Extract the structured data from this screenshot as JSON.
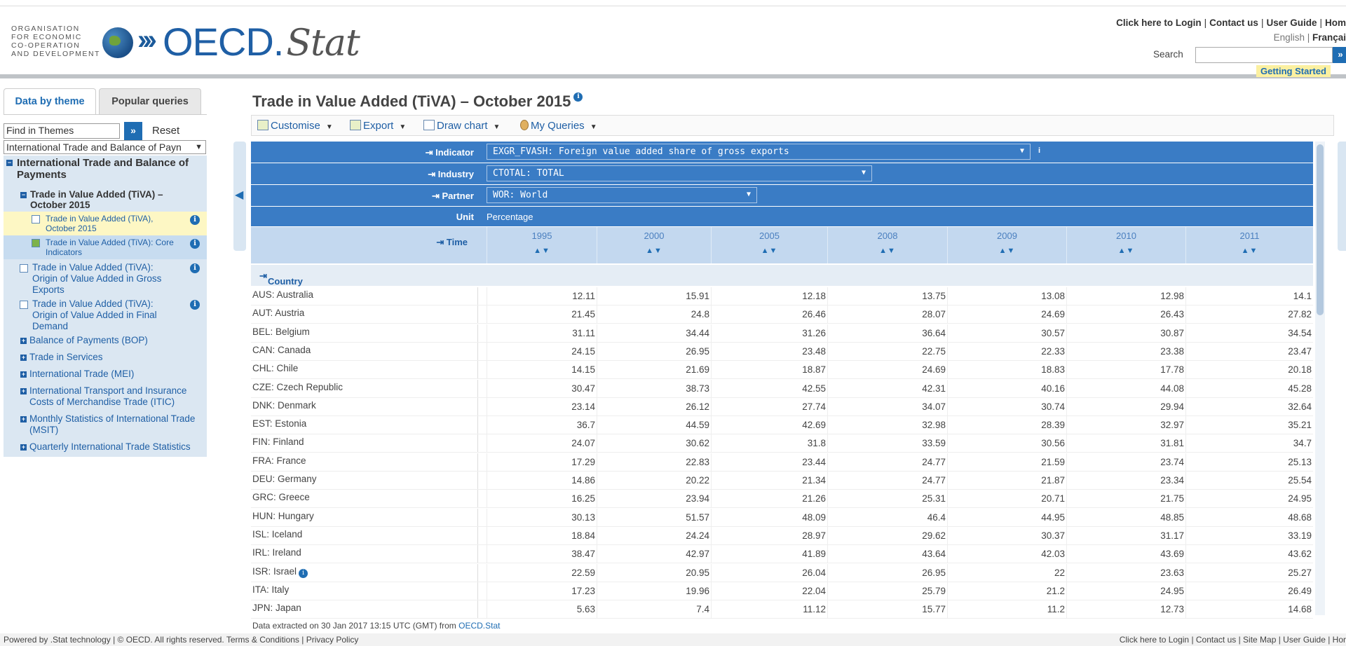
{
  "header": {
    "org_lines": [
      "ORGANISATION",
      "FOR ECONOMIC",
      "CO-OPERATION",
      "AND DEVELOPMENT"
    ],
    "logo_main": "OECD.",
    "logo_stat": "Stat",
    "links": [
      "Click here to Login",
      "Contact us",
      "User Guide",
      "Hom"
    ],
    "lang_en": "English",
    "lang_fr": "Françai",
    "search_label": "Search",
    "search_go": "»",
    "getting_started": "Getting Started"
  },
  "sidebar": {
    "tabs": [
      "Data by theme",
      "Popular queries"
    ],
    "find_placeholder": "Find in Themes",
    "find_go": "»",
    "reset": "Reset",
    "theme_select": "International Trade and Balance of Payn",
    "tree": {
      "root": "International Trade and Balance of Payments",
      "sub": "Trade in Value Added (TiVA) – October 2015",
      "leaf1": "Trade in Value Added (TiVA), October 2015",
      "leaf2": "Trade in Value Added (TiVA): Core Indicators",
      "item3": "Trade in Value Added (TiVA): Origin of Value Added in Gross Exports",
      "item4": "Trade in Value Added (TiVA): Origin of Value Added in Final Demand",
      "bop": "Balance of Payments (BOP)",
      "services": "Trade in Services",
      "mei": "International Trade (MEI)",
      "itic": "International Transport and Insurance Costs of Merchandise Trade (ITIC)",
      "msit": "Monthly Statistics of International Trade (MSIT)",
      "quarterly": "Quarterly International Trade Statistics"
    }
  },
  "main": {
    "title": "Trade in Value Added (TiVA) – October 2015",
    "toolbar": [
      "Customise",
      "Export",
      "Draw chart",
      "My Queries"
    ],
    "dims": {
      "indicator_label": "Indicator",
      "indicator_value": "EXGR_FVASH: Foreign value added share of gross exports",
      "industry_label": "Industry",
      "industry_value": "CTOTAL: TOTAL",
      "partner_label": "Partner",
      "partner_value": "WOR: World",
      "unit_label": "Unit",
      "unit_value": "Percentage",
      "time_label": "Time",
      "country_label": "Country"
    },
    "years": [
      "1995",
      "2000",
      "2005",
      "2008",
      "2009",
      "2010",
      "2011"
    ],
    "rows": [
      {
        "country": "AUS: Australia",
        "values": [
          "12.11",
          "15.91",
          "12.18",
          "13.75",
          "13.08",
          "12.98",
          "14.1"
        ]
      },
      {
        "country": "AUT: Austria",
        "values": [
          "21.45",
          "24.8",
          "26.46",
          "28.07",
          "24.69",
          "26.43",
          "27.82"
        ]
      },
      {
        "country": "BEL: Belgium",
        "values": [
          "31.11",
          "34.44",
          "31.26",
          "36.64",
          "30.57",
          "30.87",
          "34.54"
        ]
      },
      {
        "country": "CAN: Canada",
        "values": [
          "24.15",
          "26.95",
          "23.48",
          "22.75",
          "22.33",
          "23.38",
          "23.47"
        ]
      },
      {
        "country": "CHL: Chile",
        "values": [
          "14.15",
          "21.69",
          "18.87",
          "24.69",
          "18.83",
          "17.78",
          "20.18"
        ]
      },
      {
        "country": "CZE: Czech Republic",
        "values": [
          "30.47",
          "38.73",
          "42.55",
          "42.31",
          "40.16",
          "44.08",
          "45.28"
        ]
      },
      {
        "country": "DNK: Denmark",
        "values": [
          "23.14",
          "26.12",
          "27.74",
          "34.07",
          "30.74",
          "29.94",
          "32.64"
        ]
      },
      {
        "country": "EST: Estonia",
        "values": [
          "36.7",
          "44.59",
          "42.69",
          "32.98",
          "28.39",
          "32.97",
          "35.21"
        ]
      },
      {
        "country": "FIN: Finland",
        "values": [
          "24.07",
          "30.62",
          "31.8",
          "33.59",
          "30.56",
          "31.81",
          "34.7"
        ]
      },
      {
        "country": "FRA: France",
        "values": [
          "17.29",
          "22.83",
          "23.44",
          "24.77",
          "21.59",
          "23.74",
          "25.13"
        ]
      },
      {
        "country": "DEU: Germany",
        "values": [
          "14.86",
          "20.22",
          "21.34",
          "24.77",
          "21.87",
          "23.34",
          "25.54"
        ]
      },
      {
        "country": "GRC: Greece",
        "values": [
          "16.25",
          "23.94",
          "21.26",
          "25.31",
          "20.71",
          "21.75",
          "24.95"
        ]
      },
      {
        "country": "HUN: Hungary",
        "values": [
          "30.13",
          "51.57",
          "48.09",
          "46.4",
          "44.95",
          "48.85",
          "48.68"
        ]
      },
      {
        "country": "ISL: Iceland",
        "values": [
          "18.84",
          "24.24",
          "28.97",
          "29.62",
          "30.37",
          "31.17",
          "33.19"
        ]
      },
      {
        "country": "IRL: Ireland",
        "values": [
          "38.47",
          "42.97",
          "41.89",
          "43.64",
          "42.03",
          "43.69",
          "43.62"
        ]
      },
      {
        "country": "ISR: Israel",
        "values": [
          "22.59",
          "20.95",
          "26.04",
          "26.95",
          "22",
          "23.63",
          "25.27"
        ]
      },
      {
        "country": "ITA: Italy",
        "values": [
          "17.23",
          "19.96",
          "22.04",
          "25.79",
          "21.2",
          "24.95",
          "26.49"
        ]
      },
      {
        "country": "JPN: Japan",
        "values": [
          "5.63",
          "7.4",
          "11.12",
          "15.77",
          "11.2",
          "12.73",
          "14.68"
        ]
      }
    ],
    "extract_text": "Data extracted on 30 Jan 2017 13:15 UTC (GMT) from ",
    "extract_link": "OECD.Stat"
  },
  "footer": {
    "left": "Powered by .Stat technology | © OECD. All rights reserved. Terms & Conditions | Privacy Policy",
    "right": "Click here to Login | Contact us | Site Map | User Guide | Hor"
  }
}
